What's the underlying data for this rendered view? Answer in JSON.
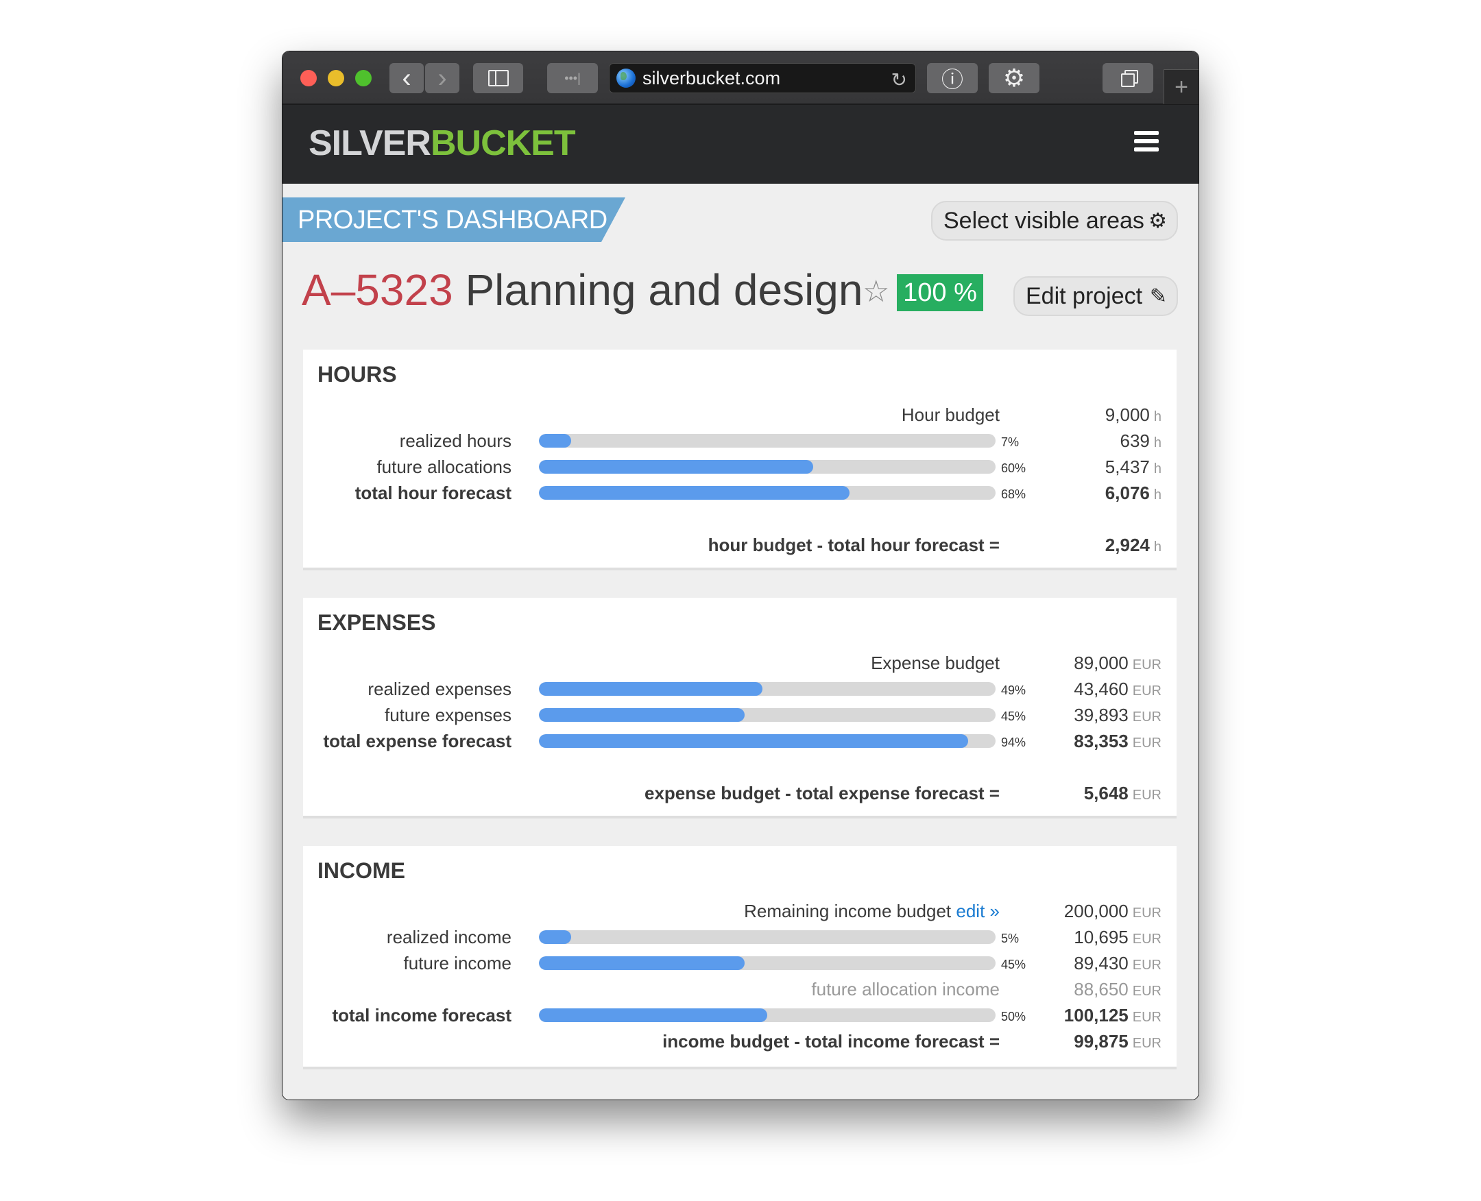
{
  "browser": {
    "url": "silverbucket.com",
    "traffic_lights": {
      "close": "#fe5f57",
      "minimize": "#e9bd2b",
      "zoom": "#4fc12d"
    },
    "icons": {
      "back": "chevron-left-icon",
      "forward": "chevron-right-icon",
      "sidebar": "sidebar-icon",
      "reader": "reader-icon",
      "reload": "reload-icon",
      "info": "info-icon",
      "extension": "gear-icon",
      "tabs": "tabs-icon",
      "new_tab": "plus-icon"
    },
    "glyphs": {
      "back": "‹",
      "forward": "›",
      "reload": "↻",
      "info": "ⓘ",
      "extension": "⚙",
      "new_tab": "+",
      "reader": "•••|"
    }
  },
  "app": {
    "logo_part1": "SILVER",
    "logo_part2": "BUCKET",
    "brand_colors": {
      "silver": "#d4d5d7",
      "bucket": "#7dc13c",
      "header_bg": "#28292b"
    }
  },
  "page": {
    "banner": "PROJECT'S DASHBOARD",
    "select_areas_label": "Select visible areas",
    "select_areas_icon": "⚙",
    "project_code": "A–5323",
    "project_name": "Planning and design",
    "star_icon": "☆",
    "completion_badge": "100 %",
    "edit_label": "Edit project",
    "edit_icon": "✎"
  },
  "sections": {
    "hours": {
      "title": "HOURS",
      "budget_label": "Hour budget",
      "budget_value": "9,000",
      "unit": "h",
      "rows": [
        {
          "label": "realized hours",
          "pct_label": "7%",
          "fraction": 0.07,
          "value": "639"
        },
        {
          "label": "future allocations",
          "pct_label": "60%",
          "fraction": 0.6,
          "value": "5,437"
        },
        {
          "label": "total hour forecast",
          "pct_label": "68%",
          "fraction": 0.68,
          "value": "6,076"
        }
      ],
      "diff_label": "hour budget - total hour forecast =",
      "diff_value": "2,924"
    },
    "expenses": {
      "title": "EXPENSES",
      "budget_label": "Expense budget",
      "budget_value": "89,000",
      "unit": "EUR",
      "rows": [
        {
          "label": "realized expenses",
          "pct_label": "49%",
          "fraction": 0.49,
          "value": "43,460"
        },
        {
          "label": "future expenses",
          "pct_label": "45%",
          "fraction": 0.45,
          "value": "39,893"
        },
        {
          "label": "total expense forecast",
          "pct_label": "94%",
          "fraction": 0.94,
          "value": "83,353"
        }
      ],
      "diff_label": "expense budget - total expense forecast =",
      "diff_value": "5,648"
    },
    "income": {
      "title": "INCOME",
      "budget_label": "Remaining income budget",
      "edit_link": "edit »",
      "budget_value": "200,000",
      "unit": "EUR",
      "rows": [
        {
          "label": "realized income",
          "pct_label": "5%",
          "fraction": 0.05,
          "value": "10,695"
        },
        {
          "label": "future income",
          "pct_label": "45%",
          "fraction": 0.45,
          "value": "89,430"
        },
        {
          "label": "total income forecast",
          "pct_label": "50%",
          "fraction": 0.5,
          "value": "100,125"
        }
      ],
      "future_allocation_label": "future allocation income",
      "future_allocation_value": "88,650",
      "diff_label": "income budget - total income forecast =",
      "diff_value": "99,875"
    }
  },
  "colors": {
    "bar_fill": "#5b9bec",
    "bar_track": "#d8d8d8",
    "badge_green": "#27ae60",
    "banner_blue": "#6aa7d2",
    "project_code_red": "#c2414b",
    "link_blue": "#1a7bd1"
  }
}
